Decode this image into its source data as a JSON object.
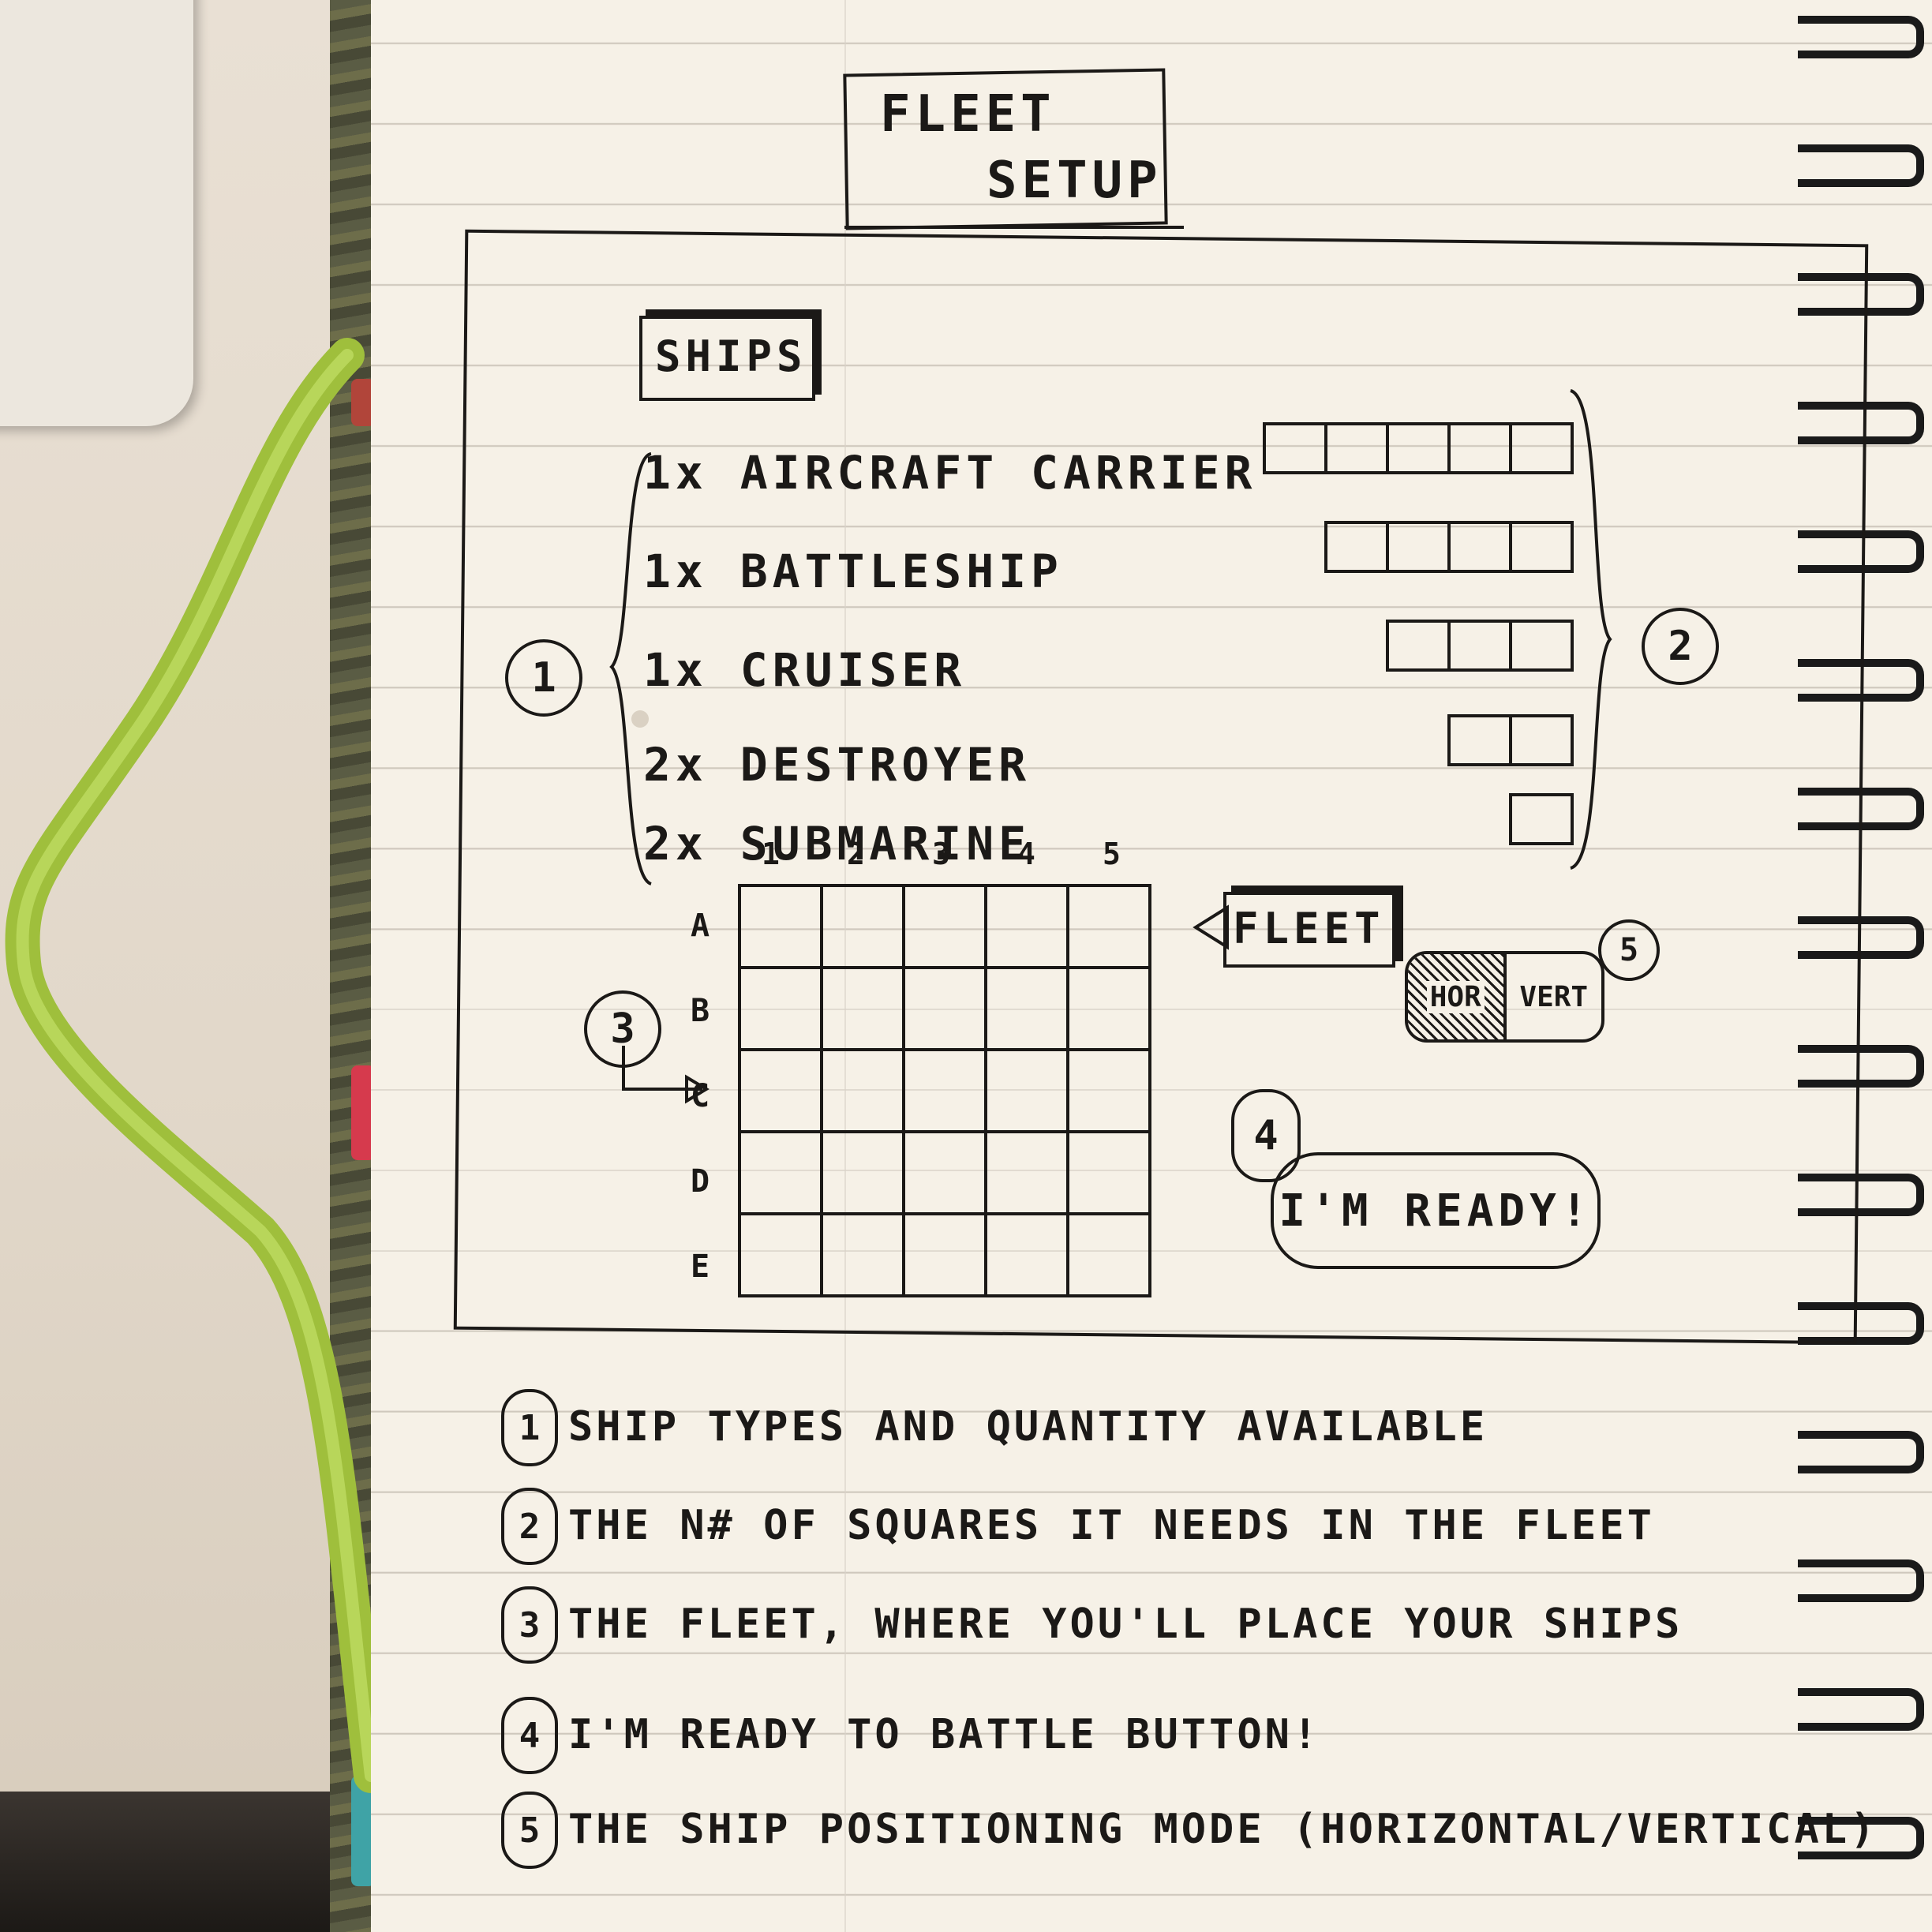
{
  "title_line1": "FLEET",
  "title_line2": "SETUP",
  "ships_tab": "SHIPS",
  "ships": [
    {
      "qty_name": "1x AIRCRAFT CARRIER",
      "squares": 5
    },
    {
      "qty_name": "1x BATTLESHIP",
      "squares": 4
    },
    {
      "qty_name": "1x CRUISER",
      "squares": 3
    },
    {
      "qty_name": "2x DESTROYER",
      "squares": 2
    },
    {
      "qty_name": "2x SUBMARINE",
      "squares": 1
    }
  ],
  "grid": {
    "columns": [
      "1",
      "2",
      "3",
      "4",
      "5"
    ],
    "rows": [
      "A",
      "B",
      "C",
      "D",
      "E"
    ]
  },
  "fleet_label": "FLEET",
  "mode_toggle": {
    "horizontal": "HOR",
    "vertical": "VERT"
  },
  "ready_button": "I'M READY!",
  "markers": {
    "m1": "1",
    "m2": "2",
    "m3": "3",
    "m4": "4",
    "m5": "5"
  },
  "notes": [
    {
      "num": "1",
      "text": "SHIP TYPES AND QUANTITY AVAILABLE"
    },
    {
      "num": "2",
      "text": "THE N# OF SQUARES IT NEEDS IN THE FLEET"
    },
    {
      "num": "3",
      "text": "THE FLEET, WHERE YOU'LL PLACE YOUR SHIPS"
    },
    {
      "num": "4",
      "text": "I'M READY TO BATTLE BUTTON!"
    },
    {
      "num": "5",
      "text": "THE SHIP POSITIONING MODE (HORIZONTAL/VERTICAL)"
    }
  ]
}
